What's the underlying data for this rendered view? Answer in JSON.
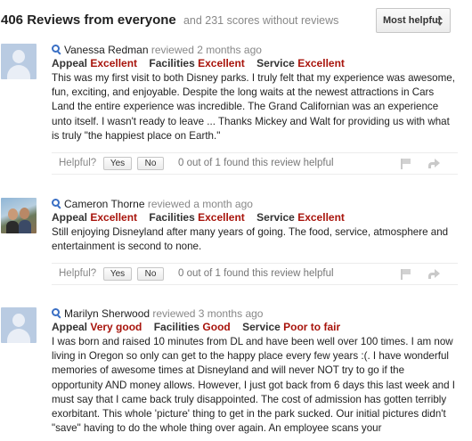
{
  "header": {
    "title": "406 Reviews from everyone",
    "subtitle": "and 231 scores without reviews",
    "sort_label": "Most helpful"
  },
  "reviews": [
    {
      "author": "Vanessa Redman",
      "meta": "reviewed 2 months ago",
      "ratings": [
        {
          "label": "Appeal",
          "value": "Excellent"
        },
        {
          "label": "Facilities",
          "value": "Excellent"
        },
        {
          "label": "Service",
          "value": "Excellent"
        }
      ],
      "text": "This was my first visit to both Disney parks. I truly felt that my experience was awesome, fun, exciting, and enjoyable. Despite the long waits at the newest attractions in Cars Land the entire experience was incredible. The Grand Californian was an experience unto itself. I wasn't ready to leave ... Thanks Mickey and Walt for providing us with what is truly \"the happiest place on Earth.\"",
      "helpful_label": "Helpful?",
      "yes_label": "Yes",
      "no_label": "No",
      "helpful_count": "0 out of 1 found this review helpful"
    },
    {
      "author": "Cameron Thorne",
      "meta": "reviewed a month ago",
      "ratings": [
        {
          "label": "Appeal",
          "value": "Excellent"
        },
        {
          "label": "Facilities",
          "value": "Excellent"
        },
        {
          "label": "Service",
          "value": "Excellent"
        }
      ],
      "text": "Still enjoying Disneyland after many years of going. The food, service, atmosphere and entertainment is second to none.",
      "helpful_label": "Helpful?",
      "yes_label": "Yes",
      "no_label": "No",
      "helpful_count": "0 out of 1 found this review helpful"
    },
    {
      "author": "Marilyn Sherwood",
      "meta": "reviewed 3 months ago",
      "ratings": [
        {
          "label": "Appeal",
          "value": "Very good"
        },
        {
          "label": "Facilities",
          "value": "Good"
        },
        {
          "label": "Service",
          "value": "Poor to fair"
        }
      ],
      "text": "I was born and raised 10 minutes from DL and have been well over 100 times. I am now living in Oregon so only can get to the happy place every few years :(. I have wonderful memories of awesome times at Disneyland and will never NOT try to go if the opportunity AND money allows. However, I just got back from 6 days this last week and I must say that I came back truly disappointed. The cost of admission has gotten terribly exorbitant. This whole 'picture' thing to get in the park sucked. Our initial pictures didn't \"save\" having to do the whole thing over again. An employee scans your"
    }
  ],
  "colors": {
    "rating_value": "#a8140c",
    "link_icon": "#3a6fc4",
    "muted_text": "#888888"
  },
  "icons": [
    "search-icon",
    "flag-icon",
    "share-icon",
    "default-avatar",
    "sort-arrows-icon"
  ]
}
